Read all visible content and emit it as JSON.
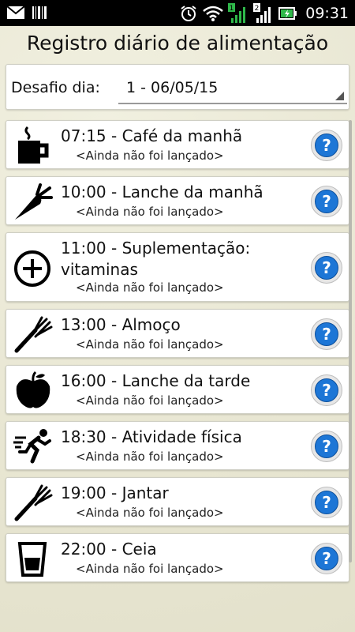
{
  "status_bar": {
    "time": "09:31",
    "sim1": "1",
    "sim2": "2"
  },
  "header": {
    "title": "Registro diário de alimentação"
  },
  "challenge": {
    "label": "Desafio dia:",
    "value": "1 - 06/05/15"
  },
  "meals": [
    {
      "title": "07:15 - Café da manhã",
      "status": "<Ainda não foi lançado>",
      "icon": "coffee-mug-icon"
    },
    {
      "title": "10:00 - Lanche da manhã",
      "status": "<Ainda não foi lançado>",
      "icon": "carrot-icon"
    },
    {
      "title": "11:00 - Suplementação: vitaminas",
      "status": "<Ainda não foi lançado>",
      "icon": "plus-circle-icon"
    },
    {
      "title": "13:00 - Almoço",
      "status": "<Ainda não foi lançado>",
      "icon": "fork-icon"
    },
    {
      "title": "16:00 - Lanche da tarde",
      "status": "<Ainda não foi lançado>",
      "icon": "apple-icon"
    },
    {
      "title": "18:30 - Atividade física",
      "status": "<Ainda não foi lançado>",
      "icon": "runner-icon"
    },
    {
      "title": "19:00 - Jantar",
      "status": "<Ainda não foi lançado>",
      "icon": "fork-icon"
    },
    {
      "title": "22:00 - Ceia",
      "status": "<Ainda não foi lançado>",
      "icon": "glass-icon"
    }
  ],
  "help_label": "?",
  "colors": {
    "help_blue": "#1d76d6",
    "background": "#ecebd9",
    "status_bar": "#000000"
  }
}
